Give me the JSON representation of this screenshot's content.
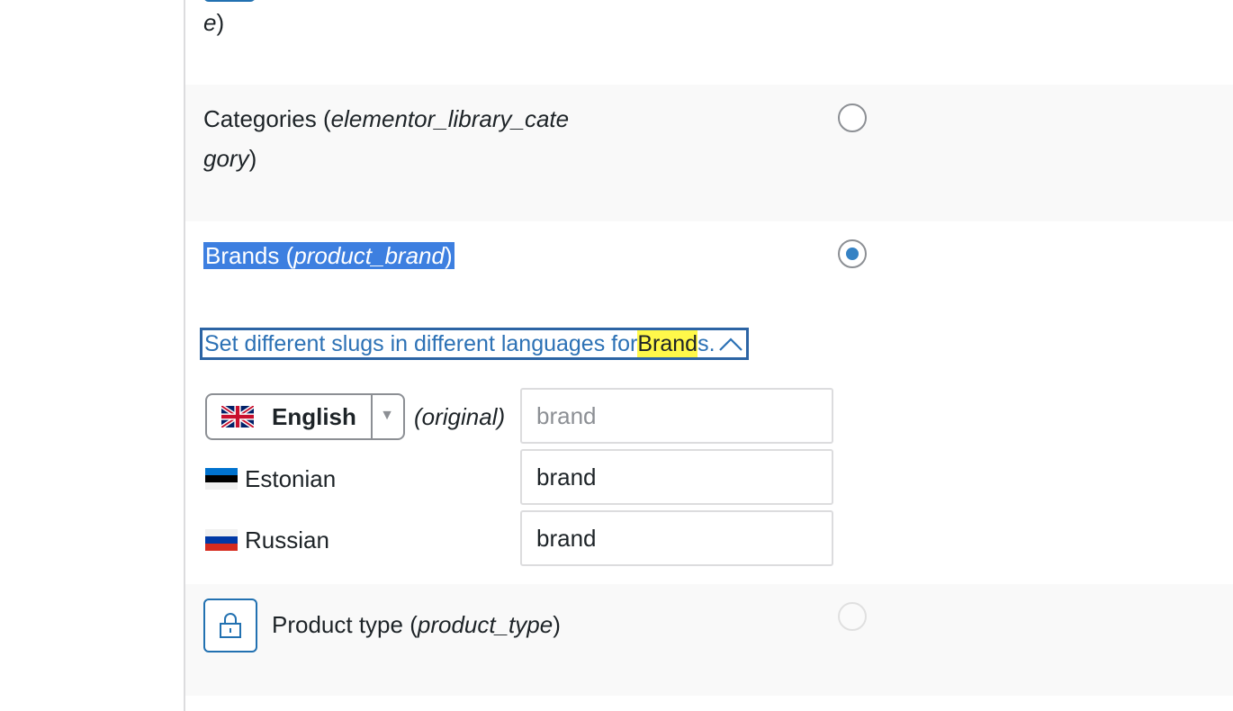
{
  "top_row": {
    "label_tail_italic": "e",
    "label_tail_close": ")"
  },
  "categories_row": {
    "name": "Categories",
    "slug_line1": "elementor_library_cate",
    "slug_line2": "gory"
  },
  "brands_row": {
    "name": "Brands",
    "slug": "product_brand",
    "toggle_text_before": "Set different slugs in different languages for ",
    "toggle_highlight": "Brand",
    "toggle_text_after": "s.",
    "language_select": {
      "selected": "English",
      "flag": "uk-flag"
    },
    "original_label": "(original)",
    "languages": [
      {
        "name": "English",
        "placeholder": "brand",
        "value": ""
      },
      {
        "name": "Estonian",
        "placeholder": "",
        "value": "brand"
      },
      {
        "name": "Russian",
        "placeholder": "",
        "value": "brand"
      }
    ]
  },
  "product_type_row": {
    "name": "Product type",
    "slug": "product_type"
  },
  "colors": {
    "selection": "#3d7fe0",
    "highlight": "#fff84a",
    "link": "#2c71b5",
    "radio_checked": "#3582c4"
  }
}
